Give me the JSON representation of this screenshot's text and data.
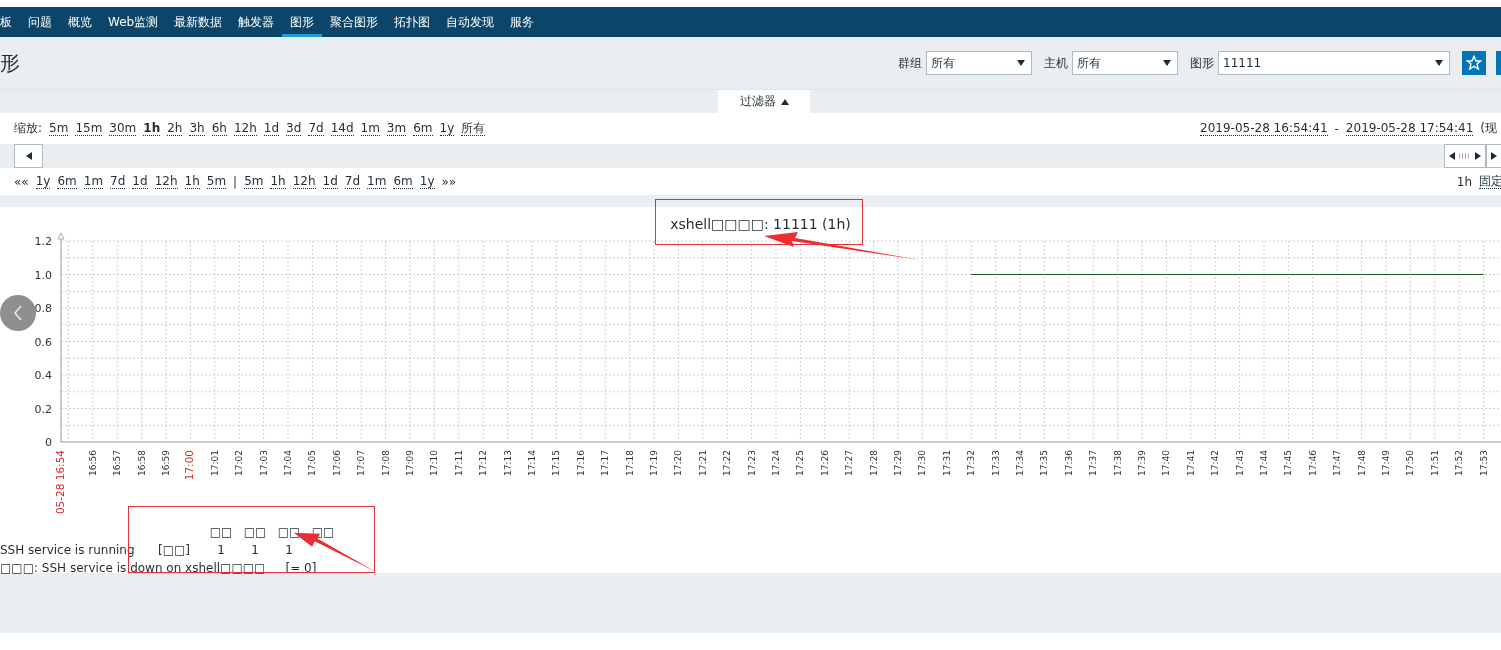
{
  "nav": {
    "items": [
      {
        "label": "板",
        "selected": false
      },
      {
        "label": "问题",
        "selected": false
      },
      {
        "label": "概览",
        "selected": false
      },
      {
        "label": "Web监测",
        "selected": false
      },
      {
        "label": "最新数据",
        "selected": false
      },
      {
        "label": "触发器",
        "selected": false
      },
      {
        "label": "图形",
        "selected": true
      },
      {
        "label": "聚合图形",
        "selected": false
      },
      {
        "label": "拓扑图",
        "selected": false
      },
      {
        "label": "自动发现",
        "selected": false
      },
      {
        "label": "服务",
        "selected": false
      }
    ]
  },
  "page_title": "形",
  "filters": [
    {
      "label": "群组",
      "value": "所有",
      "kind": "short"
    },
    {
      "label": "主机",
      "value": "所有",
      "kind": "short"
    },
    {
      "label": "图形",
      "value": "11111",
      "kind": "wide"
    }
  ],
  "filter_tab": {
    "label": "过滤器",
    "expanded": true
  },
  "zoom": {
    "label": "缩放:",
    "options": [
      {
        "label": "5m",
        "selected": false
      },
      {
        "label": "15m",
        "selected": false
      },
      {
        "label": "30m",
        "selected": false
      },
      {
        "label": "1h",
        "selected": true
      },
      {
        "label": "2h",
        "selected": false
      },
      {
        "label": "3h",
        "selected": false
      },
      {
        "label": "6h",
        "selected": false
      },
      {
        "label": "12h",
        "selected": false
      },
      {
        "label": "1d",
        "selected": false
      },
      {
        "label": "3d",
        "selected": false
      },
      {
        "label": "7d",
        "selected": false
      },
      {
        "label": "14d",
        "selected": false
      },
      {
        "label": "1m",
        "selected": false
      },
      {
        "label": "3m",
        "selected": false
      },
      {
        "label": "6m",
        "selected": false
      },
      {
        "label": "1y",
        "selected": false
      },
      {
        "label": "所有",
        "selected": false
      }
    ]
  },
  "time_range": {
    "from": "2019-05-28 16:54:41",
    "separator": "-",
    "to": "2019-05-28 17:54:41",
    "suffix": "(现"
  },
  "shift": {
    "back": "««",
    "back_options": [
      "1y",
      "6m",
      "1m",
      "7d",
      "1d",
      "12h",
      "1h",
      "5m"
    ],
    "separator": "|",
    "forward_options": [
      "5m",
      "1h",
      "12h",
      "1d",
      "7d",
      "1m",
      "6m",
      "1y"
    ],
    "forward": "»»",
    "period": "1h",
    "fixed": "固定"
  },
  "graph": {
    "title": "xshell□□□□: 11111 (1h)",
    "chart_data": {
      "type": "line",
      "ylim": [
        0,
        1.2
      ],
      "grid": true,
      "annotations": [
        {
          "x": "05-28 16:54"
        },
        {
          "x": "17:00"
        }
      ],
      "yticks": [
        {
          "value": 0,
          "label": "0"
        },
        {
          "value": 0.2,
          "label": "0.2"
        },
        {
          "value": 0.4,
          "label": "0.4"
        },
        {
          "value": 0.6,
          "label": "0.6"
        },
        {
          "value": 0.8,
          "label": "0.8"
        },
        {
          "value": 1,
          "label": "1.0"
        },
        {
          "value": 1.2,
          "label": "1.2"
        }
      ],
      "categories": [
        "05-28 16:54",
        "16:56",
        "16:57",
        "16:58",
        "16:59",
        "17:00",
        "17:01",
        "17:02",
        "17:03",
        "17:04",
        "17:05",
        "17:06",
        "17:07",
        "17:08",
        "17:09",
        "17:10",
        "17:11",
        "17:12",
        "17:13",
        "17:14",
        "17:15",
        "17:16",
        "17:17",
        "17:18",
        "17:19",
        "17:20",
        "17:21",
        "17:22",
        "17:23",
        "17:24",
        "17:25",
        "17:26",
        "17:27",
        "17:28",
        "17:29",
        "17:30",
        "17:31",
        "17:32",
        "17:33",
        "17:34",
        "17:35",
        "17:36",
        "17:37",
        "17:38",
        "17:39",
        "17:40",
        "17:41",
        "17:42",
        "17:43",
        "17:44",
        "17:45",
        "17:46",
        "17:47",
        "17:48",
        "17:49",
        "17:50",
        "17:51",
        "17:52",
        "17:53"
      ],
      "series": [
        {
          "name": "SSH service is running",
          "color": "#1a5c1a",
          "values": [
            null,
            null,
            null,
            null,
            null,
            null,
            null,
            null,
            null,
            null,
            null,
            null,
            null,
            null,
            null,
            null,
            null,
            null,
            null,
            null,
            null,
            null,
            null,
            null,
            null,
            null,
            null,
            null,
            null,
            null,
            null,
            null,
            null,
            null,
            null,
            null,
            null,
            1,
            1,
            1,
            1,
            1,
            1,
            1,
            1,
            1,
            1,
            1,
            1,
            1,
            1,
            1,
            1,
            1,
            1,
            1,
            1,
            1,
            1
          ]
        }
      ]
    },
    "legend": {
      "columns": [
        "□□",
        "□□",
        "□□",
        "□□"
      ],
      "rows": [
        {
          "kind": "item",
          "function": "[□□]",
          "values": [
            "1",
            "1",
            "1"
          ]
        },
        {
          "kind": "trigger",
          "name": "□□□: SSH service is down on xshell□□□□",
          "function": "[= 0]"
        }
      ]
    }
  }
}
